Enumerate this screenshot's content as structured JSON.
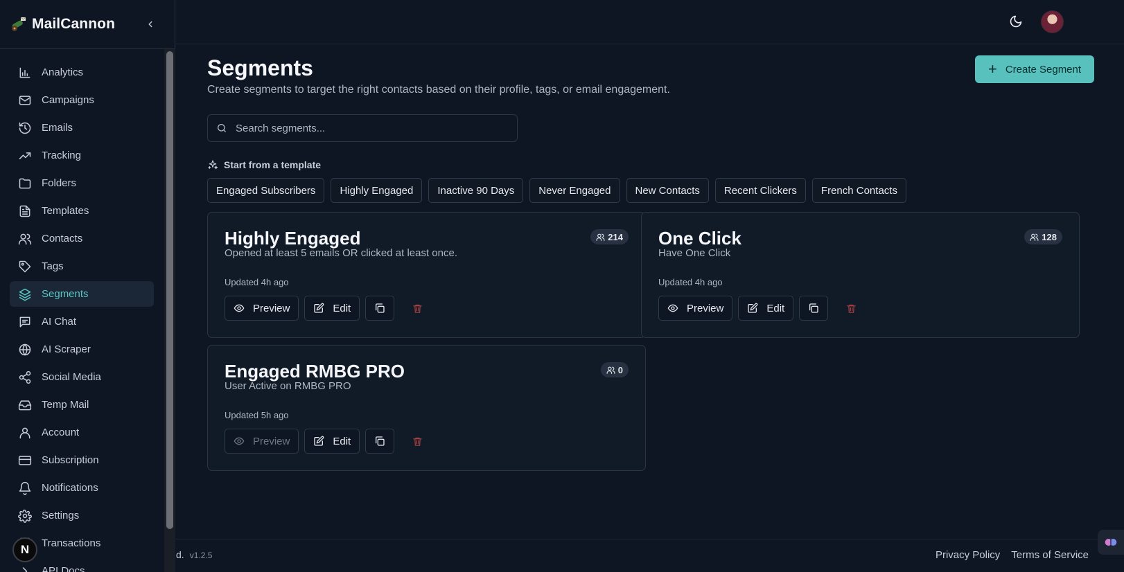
{
  "app": {
    "name": "MailCannon"
  },
  "sidebar": {
    "items": [
      {
        "label": "Analytics",
        "icon": "bar-chart-icon"
      },
      {
        "label": "Campaigns",
        "icon": "mail-icon"
      },
      {
        "label": "Emails",
        "icon": "history-icon"
      },
      {
        "label": "Tracking",
        "icon": "trending-up-icon"
      },
      {
        "label": "Folders",
        "icon": "folder-icon"
      },
      {
        "label": "Templates",
        "icon": "file-text-icon"
      },
      {
        "label": "Contacts",
        "icon": "users-icon"
      },
      {
        "label": "Tags",
        "icon": "tag-icon"
      },
      {
        "label": "Segments",
        "icon": "layers-icon",
        "active": true
      },
      {
        "label": "AI Chat",
        "icon": "message-icon"
      },
      {
        "label": "AI Scraper",
        "icon": "globe-icon"
      },
      {
        "label": "Social Media",
        "icon": "share-icon"
      },
      {
        "label": "Temp Mail",
        "icon": "inbox-icon"
      },
      {
        "label": "Account",
        "icon": "user-icon"
      },
      {
        "label": "Subscription",
        "icon": "credit-card-icon"
      },
      {
        "label": "Notifications",
        "icon": "bell-icon"
      },
      {
        "label": "Settings",
        "icon": "gear-icon"
      },
      {
        "label": "Transactions",
        "icon": "receipt-icon"
      },
      {
        "label": "API Docs",
        "icon": "chevron-right-icon"
      }
    ],
    "badge_letter": "N"
  },
  "page": {
    "title": "Segments",
    "subtitle": "Create segments to target the right contacts based on their profile, tags, or email engagement.",
    "create_label": "Create Segment",
    "search_placeholder": "Search segments...",
    "templates_heading": "Start from a template",
    "templates": [
      "Engaged Subscribers",
      "Highly Engaged",
      "Inactive 90 Days",
      "Never Engaged",
      "New Contacts",
      "Recent Clickers",
      "French Contacts"
    ]
  },
  "segments": [
    {
      "title": "Highly Engaged",
      "description": "Opened at least 5 emails OR clicked at least once.",
      "updated": "Updated 4h ago",
      "count": "214",
      "preview_disabled": false
    },
    {
      "title": "One Click",
      "description": "Have One Click",
      "updated": "Updated 4h ago",
      "count": "128",
      "preview_disabled": false
    },
    {
      "title": "Engaged RMBG PRO",
      "description": "User Active on RMBG PRO",
      "updated": "Updated 5h ago",
      "count": "0",
      "preview_disabled": true
    }
  ],
  "actions": {
    "preview": "Preview",
    "edit": "Edit"
  },
  "footer": {
    "left": "d.",
    "version": "v1.2.5",
    "privacy": "Privacy Policy",
    "terms": "Terms of Service"
  },
  "colors": {
    "accent": "#58c1bd",
    "background": "#0f1623",
    "danger": "#a43f3f"
  }
}
